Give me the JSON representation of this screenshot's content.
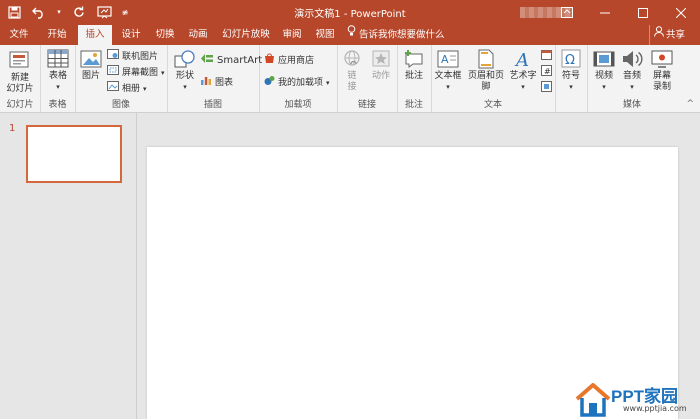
{
  "title_bar": {
    "document_title": "演示文稿1 - PowerPoint",
    "qat": [
      "save-icon",
      "undo-icon",
      "redo-icon",
      "start-from-beginning-icon",
      "customize-qat-icon"
    ],
    "window_buttons": [
      "ribbon-display-options-icon",
      "minimize-icon",
      "restore-icon",
      "close-icon"
    ]
  },
  "tabs": [
    {
      "label": "文件"
    },
    {
      "label": "开始"
    },
    {
      "label": "插入"
    },
    {
      "label": "设计"
    },
    {
      "label": "切换"
    },
    {
      "label": "动画"
    },
    {
      "label": "幻灯片放映"
    },
    {
      "label": "审阅"
    },
    {
      "label": "视图"
    }
  ],
  "active_tab": "插入",
  "tell_me": "告诉我你想要做什么",
  "share": "共享",
  "ribbon": {
    "slides": {
      "label": "幻灯片",
      "new_slide_1": "新建",
      "new_slide_2": "幻灯片"
    },
    "tables": {
      "label": "表格",
      "table": "表格"
    },
    "images": {
      "label": "图像",
      "picture": "图片",
      "online_pictures": "联机图片",
      "screenshot": "屏幕截图",
      "album": "相册"
    },
    "illustrations": {
      "label": "插图",
      "shapes": "形状",
      "smartart": "SmartArt",
      "chart": "图表"
    },
    "addins": {
      "label": "加载项",
      "store": "应用商店",
      "my_addins": "我的加载项"
    },
    "links": {
      "label": "链接",
      "link_1": "链",
      "link_2": "接",
      "action": "动作"
    },
    "comments": {
      "label": "批注",
      "comment": "批注"
    },
    "text": {
      "label": "文本",
      "textbox": "文本框",
      "header_footer": "页眉和页脚",
      "wordart": "艺术字"
    },
    "symbols": {
      "label": "",
      "symbol": "符号"
    },
    "media": {
      "label": "媒体",
      "video": "视频",
      "audio": "音频",
      "screen_rec_1": "屏幕",
      "screen_rec_2": "录制"
    }
  },
  "slide_panel": {
    "slide_number": "1"
  },
  "watermark": {
    "brand": "PPT家园",
    "url": "www.pptjia.com"
  }
}
